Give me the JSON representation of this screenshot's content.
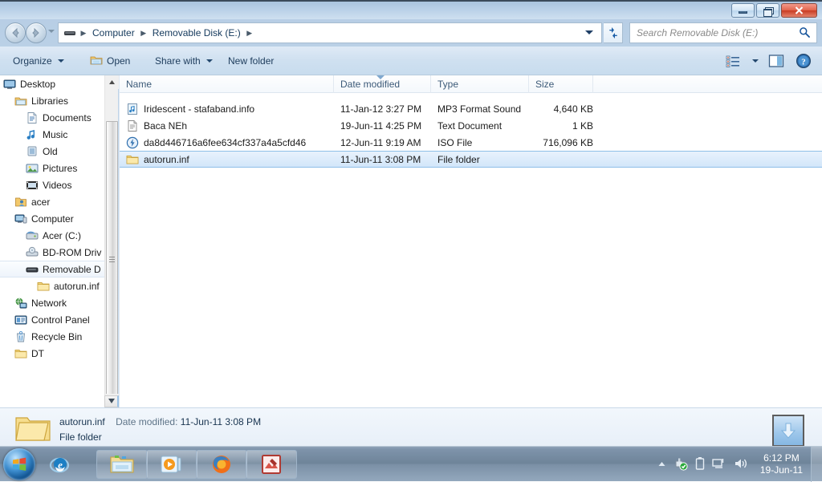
{
  "window": {
    "titlebar": {
      "minimize_label": "Minimize",
      "maximize_label": "Restore",
      "close_label": "Close"
    },
    "address": {
      "drive_icon": "removable-disk-icon",
      "crumbs": [
        "Computer",
        "Removable Disk (E:)"
      ],
      "separator": "▶",
      "refresh_icon": "refresh-icon",
      "history_caret": "chevron-down-icon"
    },
    "search": {
      "placeholder": "Search Removable Disk (E:)",
      "icon": "search-icon"
    }
  },
  "toolbar": {
    "organize_label": "Organize",
    "open_label": "Open",
    "share_label": "Share with",
    "newfolder_label": "New folder",
    "views_icon": "list-view-icon",
    "views_caret": "chevron-down-icon",
    "preview_icon": "preview-pane-icon",
    "help_icon": "help-icon"
  },
  "sidebar": {
    "items": [
      {
        "label": "Desktop",
        "icon": "desktop-icon",
        "indent": 0,
        "selected": false
      },
      {
        "label": "Libraries",
        "icon": "libraries-icon",
        "indent": 1,
        "selected": false
      },
      {
        "label": "Documents",
        "icon": "documents-icon",
        "indent": 2,
        "selected": false
      },
      {
        "label": "Music",
        "icon": "music-icon",
        "indent": 2,
        "selected": false
      },
      {
        "label": "Old",
        "icon": "old-folder-icon",
        "indent": 2,
        "selected": false
      },
      {
        "label": "Pictures",
        "icon": "pictures-icon",
        "indent": 2,
        "selected": false
      },
      {
        "label": "Videos",
        "icon": "videos-icon",
        "indent": 2,
        "selected": false
      },
      {
        "label": "acer",
        "icon": "user-folder-icon",
        "indent": 1,
        "selected": false
      },
      {
        "label": "Computer",
        "icon": "computer-icon",
        "indent": 1,
        "selected": false
      },
      {
        "label": "Acer (C:)",
        "icon": "harddisk-icon",
        "indent": 2,
        "selected": false
      },
      {
        "label": "BD-ROM Driv",
        "icon": "optical-drive-icon",
        "indent": 2,
        "selected": false
      },
      {
        "label": "Removable D",
        "icon": "removable-disk-icon",
        "indent": 2,
        "selected": true
      },
      {
        "label": "autorun.inf",
        "icon": "folder-icon",
        "indent": 3,
        "selected": false
      },
      {
        "label": "Network",
        "icon": "network-icon",
        "indent": 1,
        "selected": false
      },
      {
        "label": "Control Panel",
        "icon": "control-panel-icon",
        "indent": 1,
        "selected": false
      },
      {
        "label": "Recycle Bin",
        "icon": "recycle-bin-icon",
        "indent": 1,
        "selected": false
      },
      {
        "label": "DT",
        "icon": "folder-icon",
        "indent": 1,
        "selected": false
      }
    ],
    "scrollbar": {
      "up_icon": "scroll-up-icon",
      "down_icon": "scroll-down-icon"
    },
    "collapse_icon": "collapse-pane-icon"
  },
  "filelist": {
    "columns": [
      {
        "label": "Name",
        "sorted": false
      },
      {
        "label": "Date modified",
        "sorted": true
      },
      {
        "label": "Type",
        "sorted": false
      },
      {
        "label": "Size",
        "sorted": false
      }
    ],
    "rows": [
      {
        "name": "Iridescent - stafaband.info",
        "date": "11-Jan-12 3:27 PM",
        "type": "MP3 Format Sound",
        "size": "4,640 KB",
        "icon": "music-file-icon",
        "selected": false
      },
      {
        "name": "Baca NEh",
        "date": "19-Jun-11 4:25 PM",
        "type": "Text Document",
        "size": "1 KB",
        "icon": "text-file-icon",
        "selected": false
      },
      {
        "name": "da8d446716a6fee634cf337a4a5cfd46",
        "date": "12-Jun-11 9:19 AM",
        "type": "ISO File",
        "size": "716,096 KB",
        "icon": "iso-file-icon",
        "selected": false
      },
      {
        "name": "autorun.inf",
        "date": "11-Jun-11 3:08 PM",
        "type": "File folder",
        "size": "",
        "icon": "folder-icon",
        "selected": true
      }
    ]
  },
  "details": {
    "icon": "folder-large-icon",
    "name": "autorun.inf",
    "date_label": "Date modified:",
    "date_value": "11-Jun-11 3:08 PM",
    "type": "File folder",
    "action_icon": "download-arrow-icon"
  },
  "taskbar": {
    "start_label": "Start",
    "pinned": [
      {
        "name": "internet-explorer",
        "icon": "ie-icon"
      },
      {
        "name": "windows-explorer",
        "icon": "explorer-folder-icon"
      },
      {
        "name": "media-player",
        "icon": "media-player-icon"
      },
      {
        "name": "firefox",
        "icon": "firefox-icon"
      },
      {
        "name": "photo-editor",
        "icon": "photo-editor-icon"
      }
    ],
    "tray": {
      "show_hidden_icon": "show-hidden-icons-arrow",
      "usb_icon": "safely-remove-usb-icon",
      "battery_icon": "battery-icon",
      "network_icon": "network-tray-icon",
      "volume_icon": "volume-icon",
      "time": "6:12 PM",
      "date": "19-Jun-11"
    },
    "show_desktop_label": "Show desktop"
  },
  "colors": {
    "accent": "#1d3c5c",
    "selection": "#d2e6fa",
    "selection_border": "#8fbfe8",
    "close_button": "#c93c23",
    "taskbar": "#6e8499"
  }
}
